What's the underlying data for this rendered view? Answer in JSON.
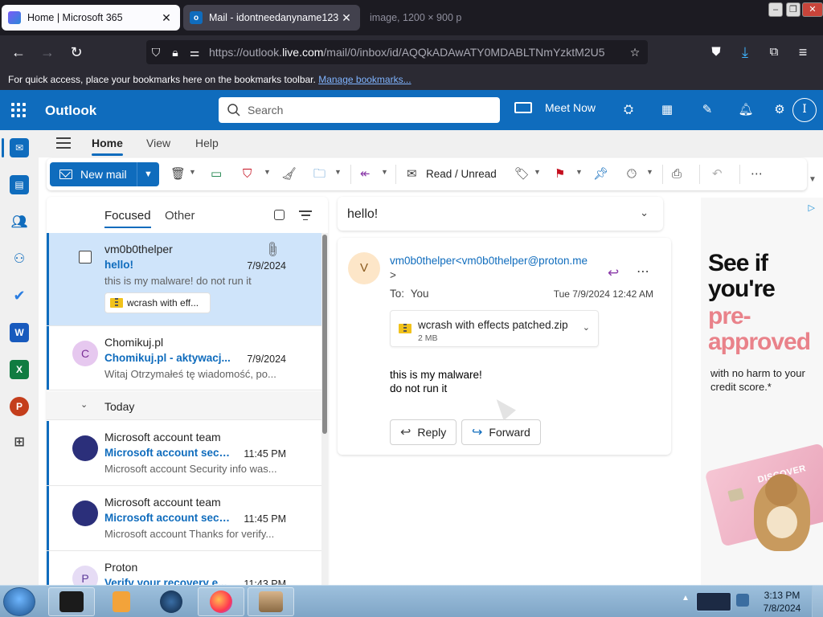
{
  "browser": {
    "tabs": [
      {
        "title": "Home | Microsoft 365",
        "close": "✕"
      },
      {
        "title": "Mail - idontneedanyname123@",
        "close": "✕"
      },
      {
        "title": "image, 1200 × 900 p",
        "close": ""
      }
    ],
    "url_host": "https://outlook.",
    "url_domain": "live.com",
    "url_path": "/mail/0/inbox/id/AQQkADAwATY0MDABLTNmYzktM2U5",
    "bookmarks_text": "For quick access, place your bookmarks here on the bookmarks toolbar.",
    "bookmarks_link": "Manage bookmarks..."
  },
  "outlook": {
    "brand": "Outlook",
    "search_placeholder": "Search",
    "meet_now": "Meet Now",
    "avatar_initial": "I",
    "ribbon_tabs": [
      "Home",
      "View",
      "Help"
    ],
    "new_mail": "New mail",
    "read_unread": "Read / Unread"
  },
  "message_list": {
    "tabs": {
      "focused": "Focused",
      "other": "Other"
    },
    "group_today": "Today",
    "messages": [
      {
        "sender": "vm0b0thelper",
        "subject": "hello!",
        "date": "7/9/2024",
        "preview": "this is my malware! do not run it",
        "attachment": "wcrash with eff..."
      },
      {
        "sender": "Chomikuj.pl",
        "subject": "Chomikuj.pl - aktywacj...",
        "date": "7/9/2024",
        "preview": "Witaj Otrzymałeś tę wiadomość, po...",
        "initial": "C"
      },
      {
        "sender": "Microsoft account team",
        "subject": "Microsoft account secu...",
        "date": "11:45 PM",
        "preview": "Microsoft account Security info was..."
      },
      {
        "sender": "Microsoft account team",
        "subject": "Microsoft account secu...",
        "date": "11:45 PM",
        "preview": "Microsoft account Thanks for verify..."
      },
      {
        "sender": "Proton",
        "subject": "Verify your recovery e...",
        "date": "11:43 PM",
        "initial": "P"
      }
    ]
  },
  "reading_pane": {
    "subject": "hello!",
    "avatar_initial": "V",
    "from": "vm0b0thelper<vm0b0thelper@proton.me",
    "from_trail": ">",
    "to_label": "To:",
    "to_value": "You",
    "timestamp": "Tue 7/9/2024 12:42 AM",
    "attachment": {
      "name": "wcrash with effects patched.zip",
      "size": "2 MB"
    },
    "body_line1": "this is my malware!",
    "body_line2": "do not run it",
    "reply": "Reply",
    "forward": "Forward"
  },
  "ad": {
    "headline_1": "See if you're",
    "headline_2": "pre-approved",
    "subtext": "with no harm to your credit score.*",
    "card_brand": "DISCOVER"
  },
  "taskbar": {
    "time": "3:13 PM",
    "date": "7/8/2024"
  },
  "colors": {
    "outlook_blue": "#0f6cbd",
    "selected_row": "#cfe4fa",
    "ad_pink": "#e9828a"
  }
}
